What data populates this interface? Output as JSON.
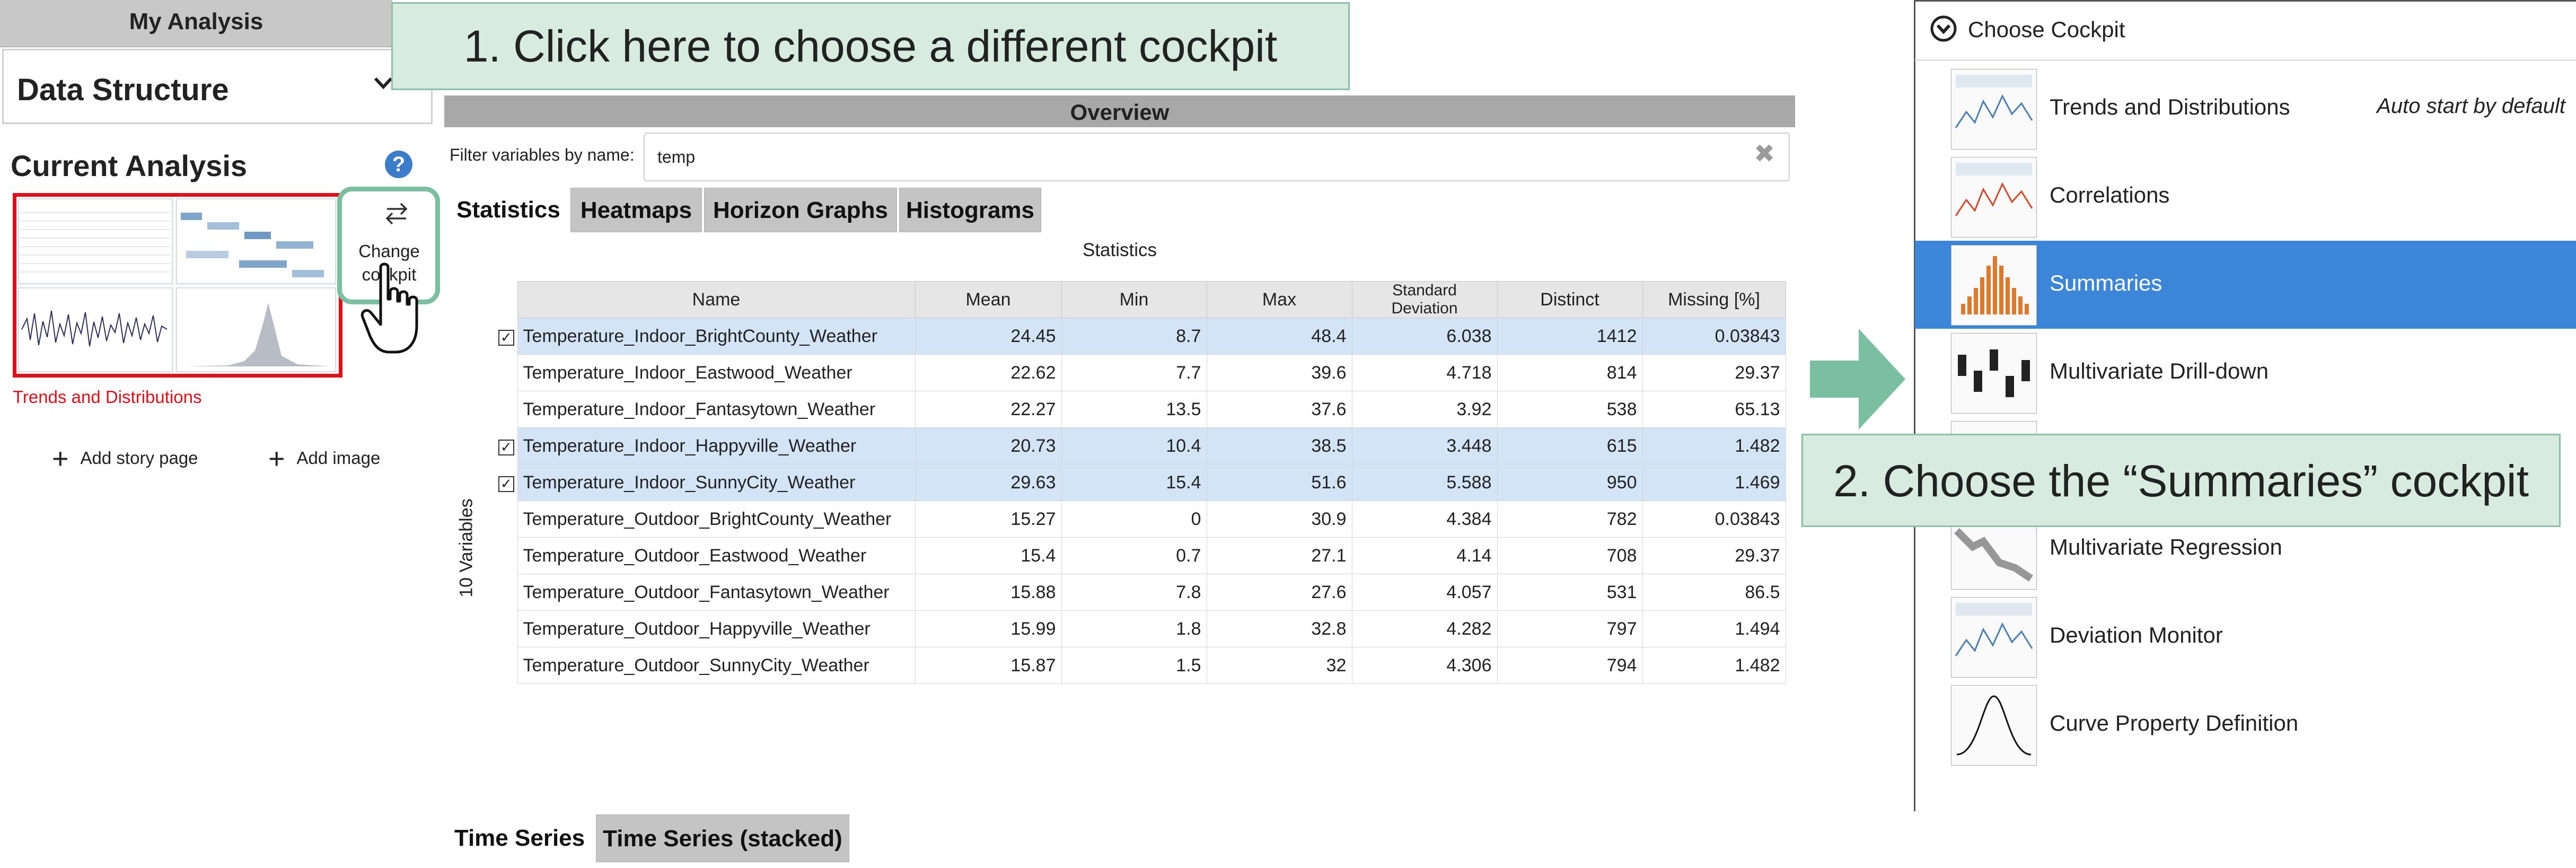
{
  "left_panel": {
    "header": "My Analysis",
    "data_structure": "Data Structure",
    "current_analysis": "Current Analysis",
    "help": "?",
    "thumbnail_caption": "Trends and Distributions",
    "change_cockpit_line1": "Change",
    "change_cockpit_line2": "cockpit",
    "add_story_page": "Add story page",
    "add_image": "Add image",
    "plus": "+"
  },
  "callout1": "1. Click here to choose a different cockpit",
  "callout2": "2. Choose the “Summaries” cockpit",
  "overview": {
    "title": "Overview",
    "filter_label": "Filter variables by name:",
    "filter_value": "temp",
    "filter_clear": "✖",
    "tabs": [
      "Statistics",
      "Heatmaps",
      "Horizon Graphs",
      "Histograms"
    ],
    "active_tab": "Statistics",
    "stats_caption": "Statistics",
    "variables_count": "10 Variables",
    "columns": [
      "Name",
      "Mean",
      "Min",
      "Max",
      "Standard Deviation",
      "Distinct",
      "Missing [%]"
    ],
    "rows": [
      {
        "checked": true,
        "name": "Temperature_Indoor_BrightCounty_Weather",
        "mean": "24.45",
        "min": "8.7",
        "max": "48.4",
        "std": "6.038",
        "distinct": "1412",
        "missing": "0.03843"
      },
      {
        "checked": false,
        "name": "Temperature_Indoor_Eastwood_Weather",
        "mean": "22.62",
        "min": "7.7",
        "max": "39.6",
        "std": "4.718",
        "distinct": "814",
        "missing": "29.37"
      },
      {
        "checked": false,
        "name": "Temperature_Indoor_Fantasytown_Weather",
        "mean": "22.27",
        "min": "13.5",
        "max": "37.6",
        "std": "3.92",
        "distinct": "538",
        "missing": "65.13"
      },
      {
        "checked": true,
        "name": "Temperature_Indoor_Happyville_Weather",
        "mean": "20.73",
        "min": "10.4",
        "max": "38.5",
        "std": "3.448",
        "distinct": "615",
        "missing": "1.482"
      },
      {
        "checked": true,
        "name": "Temperature_Indoor_SunnyCity_Weather",
        "mean": "29.63",
        "min": "15.4",
        "max": "51.6",
        "std": "5.588",
        "distinct": "950",
        "missing": "1.469"
      },
      {
        "checked": false,
        "name": "Temperature_Outdoor_BrightCounty_Weather",
        "mean": "15.27",
        "min": "0",
        "max": "30.9",
        "std": "4.384",
        "distinct": "782",
        "missing": "0.03843"
      },
      {
        "checked": false,
        "name": "Temperature_Outdoor_Eastwood_Weather",
        "mean": "15.4",
        "min": "0.7",
        "max": "27.1",
        "std": "4.14",
        "distinct": "708",
        "missing": "29.37"
      },
      {
        "checked": false,
        "name": "Temperature_Outdoor_Fantasytown_Weather",
        "mean": "15.88",
        "min": "7.8",
        "max": "27.6",
        "std": "4.057",
        "distinct": "531",
        "missing": "86.5"
      },
      {
        "checked": false,
        "name": "Temperature_Outdoor_Happyville_Weather",
        "mean": "15.99",
        "min": "1.8",
        "max": "32.8",
        "std": "4.282",
        "distinct": "797",
        "missing": "1.494"
      },
      {
        "checked": false,
        "name": "Temperature_Outdoor_SunnyCity_Weather",
        "mean": "15.87",
        "min": "1.5",
        "max": "32",
        "std": "4.306",
        "distinct": "794",
        "missing": "1.482"
      }
    ],
    "bottom_tabs": [
      "Time Series",
      "Time Series (stacked)"
    ]
  },
  "cockpit": {
    "title": "Choose Cockpit",
    "items": [
      {
        "label": "Trends and Distributions",
        "note": "Auto start by default",
        "selected": false
      },
      {
        "label": "Correlations",
        "note": "",
        "selected": false
      },
      {
        "label": "Summaries",
        "note": "",
        "selected": true
      },
      {
        "label": "Multivariate Drill-down",
        "note": "",
        "selected": false
      },
      {
        "label": "",
        "note": "",
        "selected": false
      },
      {
        "label": "Multivariate Regression",
        "note": "",
        "selected": false
      },
      {
        "label": "Deviation Monitor",
        "note": "",
        "selected": false
      },
      {
        "label": "Curve Property Definition",
        "note": "",
        "selected": false
      }
    ]
  },
  "colors": {
    "accent_blue": "#3b86d8",
    "callout_bg": "#d7ebe1",
    "callout_border": "#8bbfa7",
    "highlight_red": "#e0101a",
    "selected_row": "#d4e4f7"
  }
}
